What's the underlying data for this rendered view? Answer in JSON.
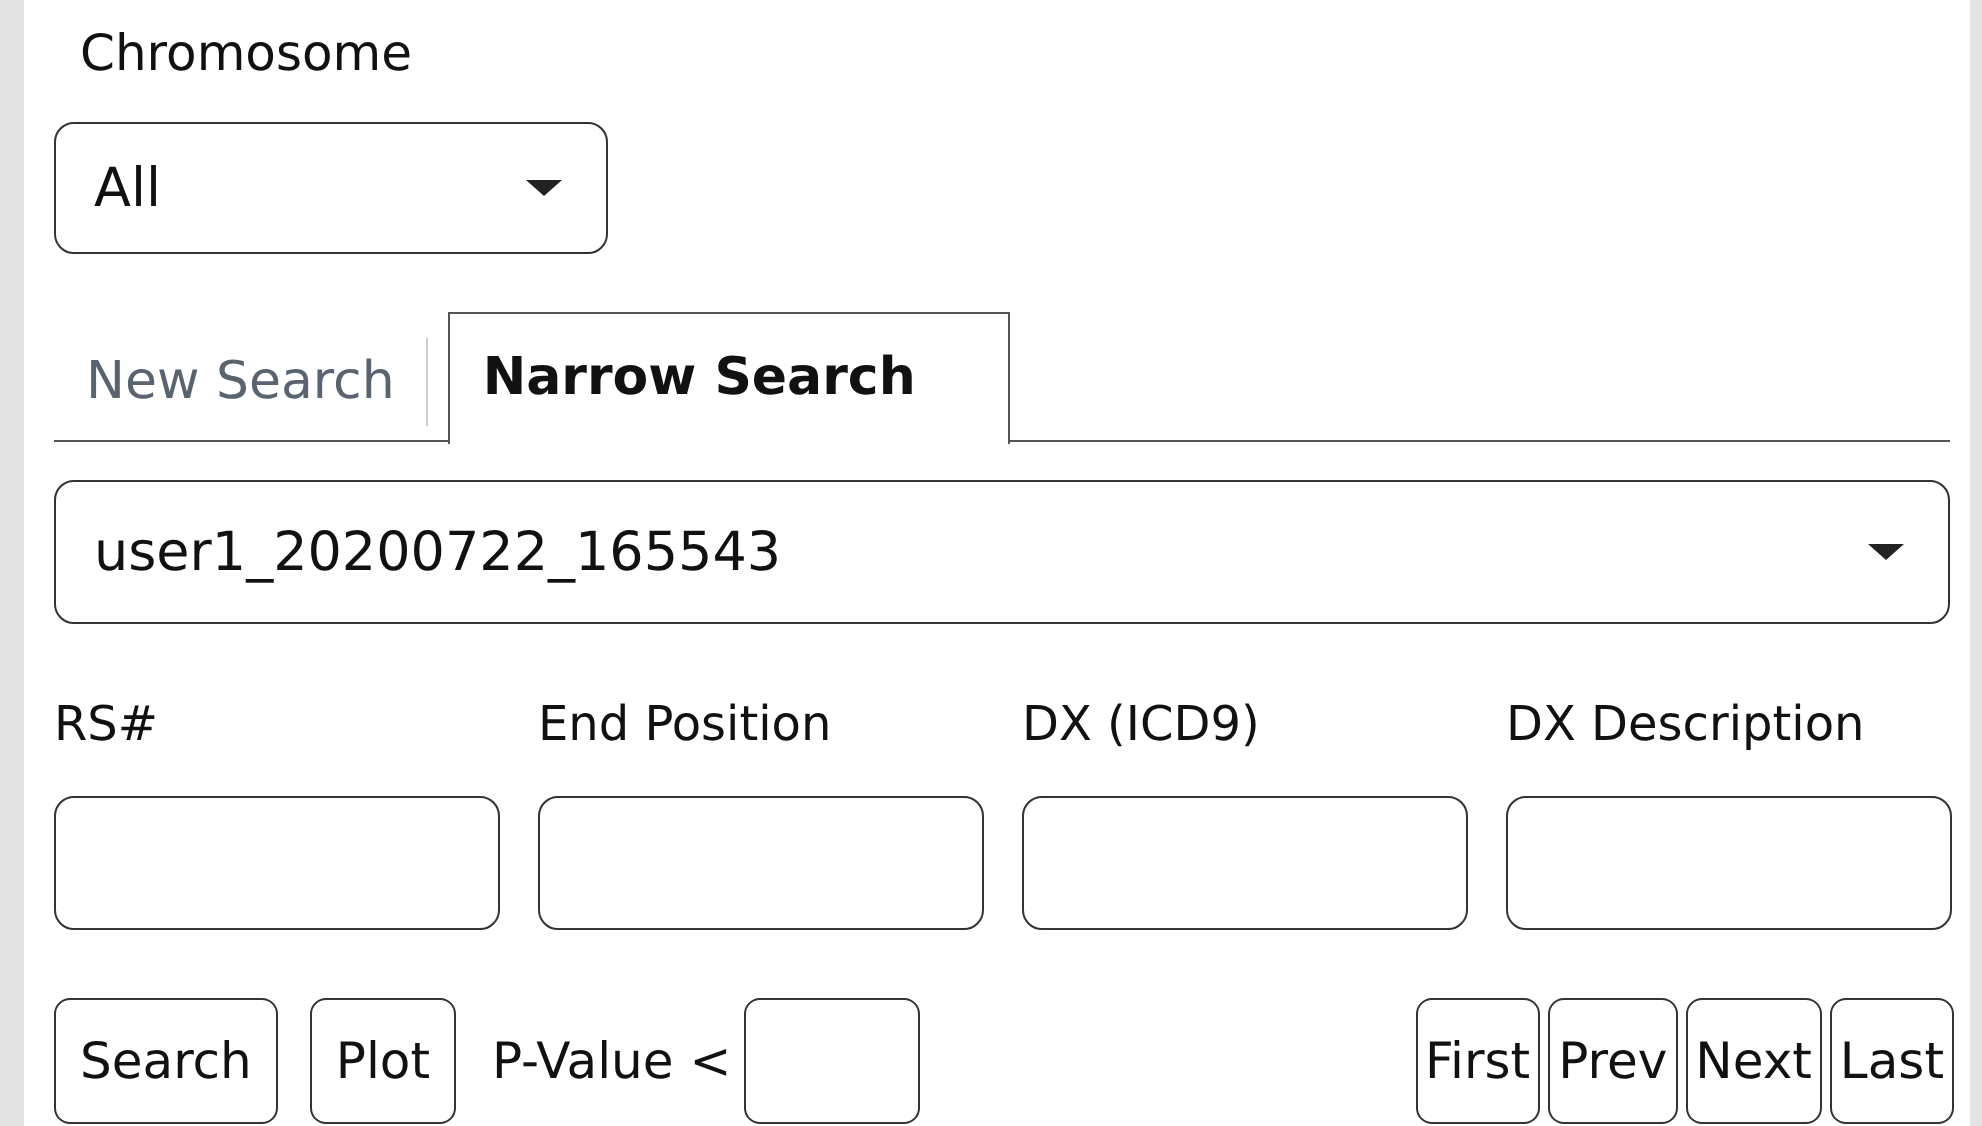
{
  "chromosome": {
    "label": "Chromosome",
    "value": "All"
  },
  "tabs": [
    {
      "label": "New Search",
      "selected": false
    },
    {
      "label": "Narrow Search",
      "selected": true
    }
  ],
  "search_select": {
    "value": "user1_20200722_165543"
  },
  "fields": [
    {
      "label": "RS#"
    },
    {
      "label": "End Position"
    },
    {
      "label": "DX (ICD9)"
    },
    {
      "label": "DX Description"
    }
  ],
  "buttons": [
    "Search",
    "Plot"
  ],
  "p_value": {
    "label": "P-Value <"
  },
  "pager": [
    "First",
    "Prev",
    "Next",
    "Last"
  ]
}
